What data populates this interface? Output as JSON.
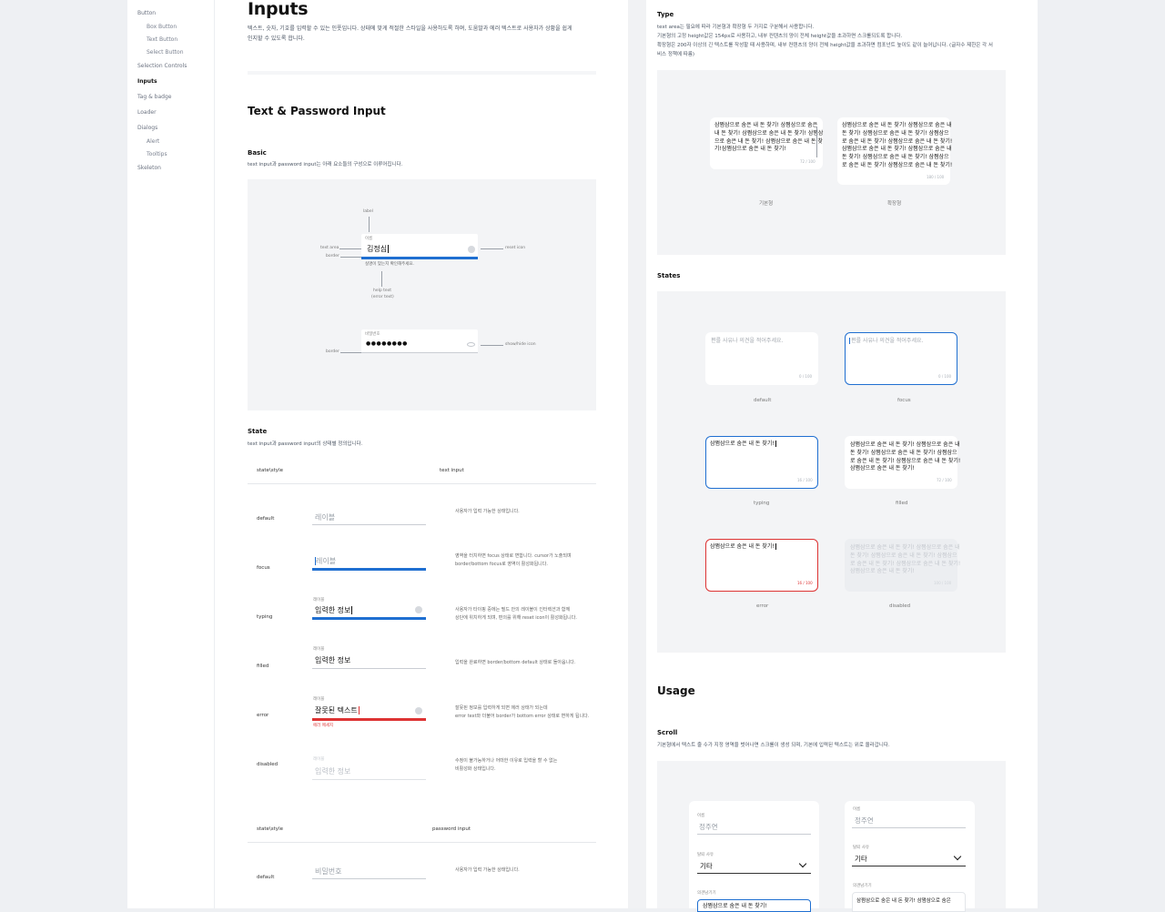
{
  "sidebar": {
    "items": [
      {
        "label": "Button",
        "level": 0
      },
      {
        "label": "Box Button",
        "level": 1
      },
      {
        "label": "Text Button",
        "level": 1
      },
      {
        "label": "Select Button",
        "level": 1
      },
      {
        "label": "Selection Controls",
        "level": 0
      },
      {
        "label": "Inputs",
        "level": 0,
        "active": true
      },
      {
        "label": "Tag & badge",
        "level": 0
      },
      {
        "label": "Loader",
        "level": 0
      },
      {
        "label": "Dialogs",
        "level": 0
      },
      {
        "label": "Alert",
        "level": 1
      },
      {
        "label": "Tooltips",
        "level": 1
      },
      {
        "label": "Skeleton",
        "level": 0
      }
    ]
  },
  "header": {
    "title": "Inputs",
    "intro_1": "텍스트, 숫자, 기호를 입력할 수 있는 인풋입니다. 상태에 맞게 적절한 스타일을 사용하도록 하며, 도움말과 에러 텍스트로 사용자가 상황을 쉽게",
    "intro_2": "인지할 수 있도록 합니다."
  },
  "text_password": {
    "title": "Text & Password Input",
    "basic_title": "Basic",
    "basic_desc": "text input과 password input는 아래 요소들의 구성으로 이루어집니다.",
    "anatomy": {
      "label": "label",
      "text_area": "text area",
      "border": "border",
      "reset_icon": "reset icon",
      "help_text_1": "help text",
      "help_text_2": "(error text)",
      "field_label": "이름",
      "field_value": "김정심",
      "field_help": "실명이 맞는지 확인해주세요.",
      "pw_label": "비밀번호",
      "pw_value": "●●●●●●●●",
      "pw_border": "border",
      "pw_icon": "show/hide icon"
    },
    "state_title": "State",
    "state_desc": "text input과 password input의 상태별 정의입니다.",
    "table_head": {
      "col1": "state\\style",
      "col2": "text input"
    },
    "rows": [
      {
        "state": "default",
        "label": "",
        "value": "레이블",
        "desc_1": "사용자가 입력 가능한 상태입니다.",
        "desc_2": ""
      },
      {
        "state": "focus",
        "label": "",
        "value": "레이블",
        "desc_1": "영역을 터치하면 focus 상태로 변합니다. cursor가 노출되며",
        "desc_2": "border/bottom focus로 영역이 활성화됩니다."
      },
      {
        "state": "typing",
        "label": "레이블",
        "value": "입력한 정보",
        "desc_1": "사용자가 타이핑 중에는 필드 안의 레이블이 인터렉션과 함께",
        "desc_2": "상단에 위치하게 되며, 편의를 위해 reset icon이 활성화됩니다."
      },
      {
        "state": "filled",
        "label": "레이블",
        "value": "입력한 정보",
        "desc_1": "입력을 완료하면 border/bottom default 상태로 돌아옵니다.",
        "desc_2": ""
      },
      {
        "state": "error",
        "label": "레이블",
        "value": "잘못된 텍스트",
        "error": "에러 메세지",
        "desc_1": "잘못된 정보를 입력하게 되면 에러 상태가 되는데",
        "desc_2": "error text와 더불어 border가 bottom error 상태로 변하게 됩니다."
      },
      {
        "state": "disabled",
        "label": "레이블",
        "value": "입력한 정보",
        "desc_1": "수정이 불가능하거나 어떠한 이유로 입력을 할 수 없는",
        "desc_2": "비활성화 상태입니다."
      }
    ],
    "pw_table_head": {
      "col1": "state\\style",
      "col2": "password input"
    },
    "pw_rows": [
      {
        "state": "default",
        "value": "비밀번호",
        "desc_1": "사용자가 입력 가능한 상태입니다."
      }
    ]
  },
  "textarea": {
    "type_title": "Type",
    "type_desc_1": "text area는 필요에 따라 기본형과 확장형 두 가지로 구분해서 사용합니다.",
    "type_desc_2": "기본형의 고정 height값은 154px로 사용하고, 내부 컨텐츠의 양이 전체 height값을 초과하면 스크롤되도록 합니다.",
    "type_desc_3": "확장형은 200자 이상의 긴 텍스트를 작성할 때 사용하며, 내부 컨텐츠의 양이 전체 height값을 초과하면 컴포넌트 높이도 같이 늘어납니다. (글자수 제한은 각 서",
    "type_desc_4": "비스 정책에 따름)",
    "sample_lines_basic": [
      "삼쩜삼으로 숨은 내 돈 찾기! 삼쩜삼으로 숨은",
      "내 돈 찾기! 삼쩜삼으로 숨은 내 돈 찾기! 삼쩜삼",
      "으로 숨은 내 돈 찾기! 삼쩜삼으로 숨은 내 돈 찾",
      "기!삼쩜삼으로 숨은 내 돈 찾기!"
    ],
    "sample_lines_ext": [
      "삼쩜삼으로 숨은 내 돈 찾기! 삼쩜삼으로 숨은 내",
      "돈 찾기! 삼쩜삼으로 숨은 내 돈 찾기! 삼쩜삼으",
      "로 숨은 내 돈 찾기! 삼쩜삼으로 숨은 내 돈 찾기!",
      "삼쩜삼으로 숨은 내 돈 찾기! 삼쩜삼으로 숨은 내",
      "돈 찾기! 삼쩜삼으로 숨은 내 돈 찾기! 삼쩜삼으",
      "로 숨은 내 돈 찾기! 삼쩜삼으로 숨은 내 돈 찾기!"
    ],
    "count_basic": "72 / 100",
    "count_ext": "180 / 100",
    "cap_basic": "기본형",
    "cap_ext": "확장형",
    "states_title": "States",
    "placeholder": "편를 사유나 의견을 적어주세요.",
    "count_zero": "0 / 100",
    "typing_text": "삼쩜삼으로 숨은 내 돈 찾기!",
    "count_typing": "16 / 100",
    "filled_lines": [
      "삼쩜삼으로 숨은 내 돈 찾기! 삼쩜삼으로 숨은 내",
      "돈 찾기! 삼쩜삼으로 숨은 내 돈 찾기! 삼쩜삼으",
      "로 숨은 내 돈 찾기! 삼쩜삼으로 숨은 내 돈 찾기!",
      "삼쩜삼으로 숨은 내 돈 찾기!"
    ],
    "count_filled": "72 / 100",
    "error_text": "삼쩜삼으로 숨은 내 돈 찾기!",
    "count_error": "16 / 100",
    "disabled_lines": [
      "삼쩜삼으로 숨은 내 돈 찾기! 삼쩜삼으로 숨은 내",
      "돈 찾기! 삼쩜삼으로 숨은 내 돈 찾기! 삼쩜삼으",
      "로 숨은 내 돈 찾기! 삼쩜삼으로 숨은 내 돈 찾기!",
      "삼쩜삼으로 숨은 내 돈 찾기!"
    ],
    "count_disabled": "100 / 100",
    "caps": {
      "default": "default",
      "focus": "focus",
      "typing": "typing",
      "filled": "filled",
      "error": "error",
      "disabled": "disabled"
    }
  },
  "usage": {
    "title": "Usage",
    "scroll_title": "Scroll",
    "scroll_desc": "기본형에서 텍스트 줄 수가 지정 영역을 벗어나면 스크롤이 생성 되며, 기본에 입력된 텍스트는 위로 올라갑니다.",
    "left": {
      "name_label": "이름",
      "name_value": "정주연",
      "reason_label": "탈퇴 사유",
      "reason_value": "기타",
      "extra_label": "의견남기기",
      "extra_value": "삼쩜삼으로 숨은 내 돈 찾기!"
    },
    "right": {
      "name_label": "이름",
      "name_value": "정주연",
      "reason_label": "탈퇴 사유",
      "reason_value": "기타",
      "extra_label": "의견남기기",
      "extra_value": "삼쩜삼으로 숨은 내 돈 찾기! 삼쩜삼으로 숨은"
    }
  },
  "colors": {
    "accent": "#1f6fd1",
    "error": "#d33333",
    "panel": "#f3f4f6"
  }
}
